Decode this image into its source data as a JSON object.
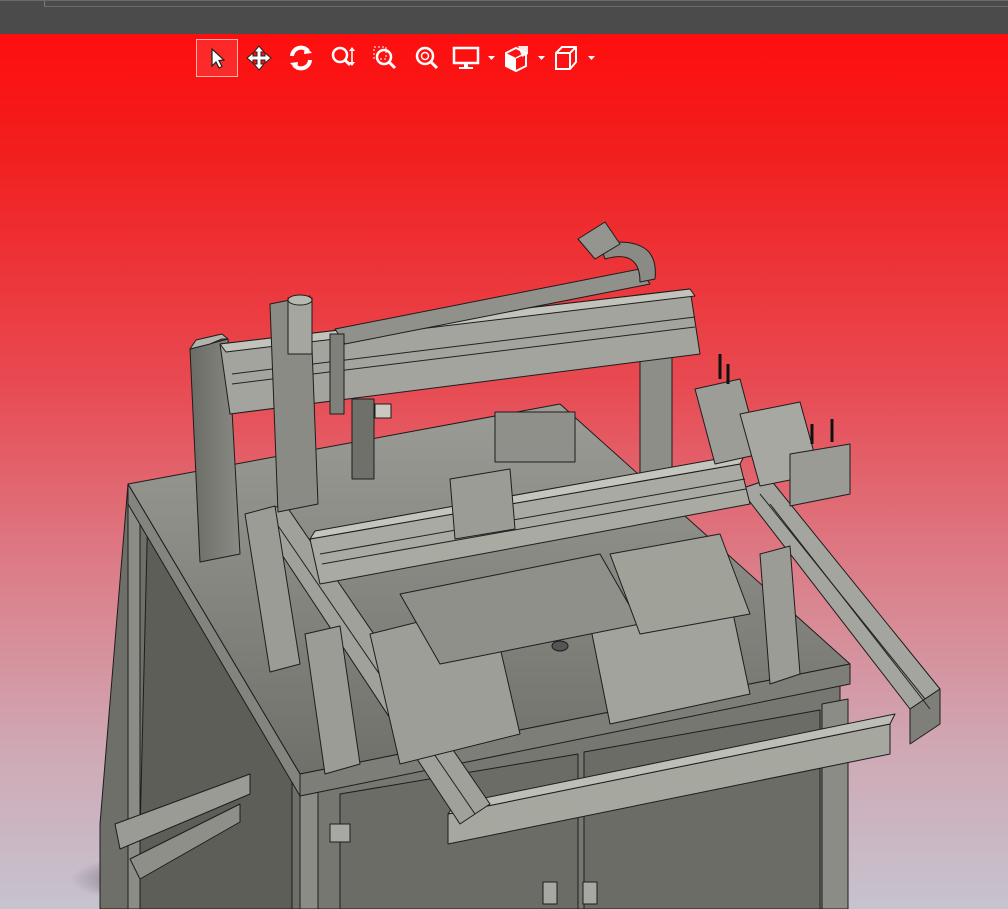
{
  "app": {
    "title": ""
  },
  "viewport": {
    "background_top": "#ff0e0e",
    "background_bottom": "#c6c3cf",
    "model_color": "#8e8f88",
    "model_outline": "#1d1d1d"
  },
  "toolbar": {
    "buttons": [
      {
        "id": "select",
        "icon": "cursor-arrow-icon",
        "active": true
      },
      {
        "id": "pan",
        "icon": "move-arrows-icon",
        "active": false
      },
      {
        "id": "rotate",
        "icon": "rotate-view-icon",
        "active": false
      },
      {
        "id": "zoom-in-out",
        "icon": "zoom-in-out-icon",
        "active": false
      },
      {
        "id": "zoom-area",
        "icon": "zoom-to-area-icon",
        "active": false
      },
      {
        "id": "zoom-fit",
        "icon": "zoom-to-fit-icon",
        "active": false
      },
      {
        "id": "display-style",
        "icon": "display-monitor-icon",
        "has_dropdown": true
      },
      {
        "id": "section-view",
        "icon": "section-view-icon",
        "has_dropdown": true
      },
      {
        "id": "view-orientation",
        "icon": "cube-orientation-icon",
        "has_dropdown": true
      }
    ]
  }
}
